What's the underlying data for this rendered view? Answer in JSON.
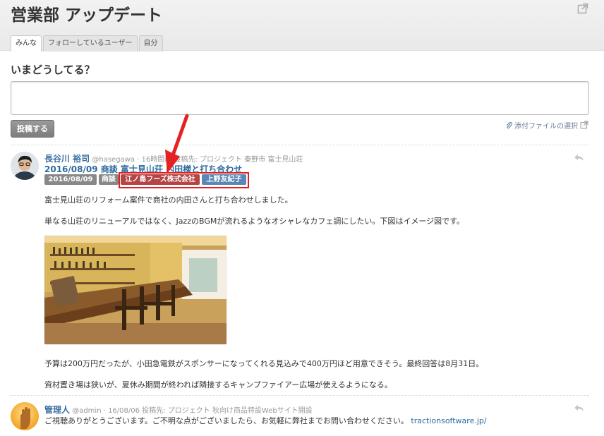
{
  "header": {
    "title": "営業部 アップデート",
    "tabs": [
      "みんな",
      "フォローしているユーザー",
      "自分"
    ],
    "active_tab": "みんな"
  },
  "compose": {
    "prompt": "いまどうしてる？",
    "post_button": "投稿する",
    "attach_label": "添付ファイルの選択"
  },
  "posts": [
    {
      "author": "長谷川 裕司",
      "handle": "@hasegawa",
      "meta": "· 16時間前 投稿先: プロジェクト 秦野市 富士見山荘",
      "title_prefix": "2016/08/09 商談 ",
      "title_link": "富士見山荘 内田様と打ち合わせ",
      "tags": [
        "2016/08/09",
        "商談",
        "江ノ島フーズ株式会社",
        "上野友紀子"
      ],
      "paragraphs": [
        "富士見山荘のリフォーム案件で商社の内田さんと打ち合わせしました。",
        "単なる山荘のリニューアルではなく、JazzのBGMが流れるようなオシャレなカフェ調にしたい。下図はイメージ図です。",
        "予算は200万円だったが、小田急電鉄がスポンサーになってくれる見込みで400万円ほど用意できそう。最終回答は8月31日。",
        "資材置き場は狭いが、夏休み期間が終われば隣接するキャンプファイアー広場が使えるようになる。"
      ]
    },
    {
      "author": "管理人",
      "handle": "@admin",
      "meta": "· 16/08/06 投稿先: プロジェクト 秋向け商品特設Webサイト開設",
      "message": "ご視聴ありがとうございます。ご不明な点がございましたら、お気軽に弊社までお問い合わせください。",
      "link": "tractionsoftware.jp/"
    }
  ],
  "colors": {
    "accent_link": "#2d6b9e",
    "highlight": "#e02020",
    "tag_red": "#b44545",
    "tag_blue": "#5a88b5"
  }
}
